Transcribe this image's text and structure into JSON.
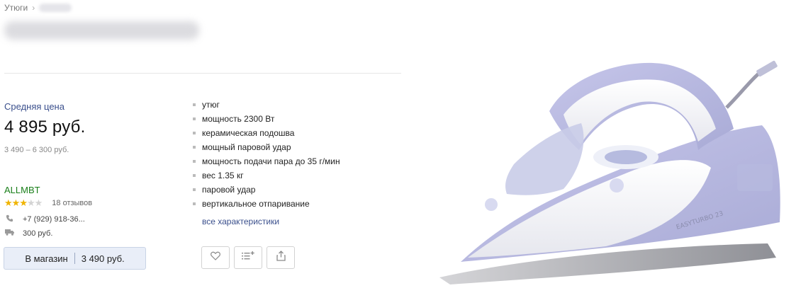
{
  "breadcrumb": {
    "parent": "Утюги"
  },
  "offer": {
    "price_label": "Средняя цена",
    "price": "4 895 руб.",
    "price_range": "3 490 – 6 300 руб."
  },
  "shop": {
    "name": "ALLMBT",
    "rating": 3,
    "rating_max": 5,
    "reviews": "18 отзывов",
    "phone": "+7 (929) 918-36...",
    "delivery": "300 руб.",
    "button_label": "В магазин",
    "button_price": "3 490 руб."
  },
  "specs": [
    "утюг",
    "мощность 2300 Вт",
    "керамическая подошва",
    "мощный паровой удар",
    "мощность подачи пара до 35 г/мин",
    "вес 1.35 кг",
    "паровой удар",
    "вертикальное отпаривание"
  ],
  "all_specs_link": "все характеристики",
  "product": {
    "body_label": "EASYTURBO 23"
  },
  "icons": {
    "favorite": "heart-icon",
    "compare": "compare-list-icon",
    "share": "share-icon",
    "phone": "phone-icon",
    "delivery": "truck-icon"
  },
  "colors": {
    "link": "#3a4f8c",
    "shop": "#1a7f1a",
    "star": "#f0b400",
    "button_bg": "#e9eef8"
  }
}
